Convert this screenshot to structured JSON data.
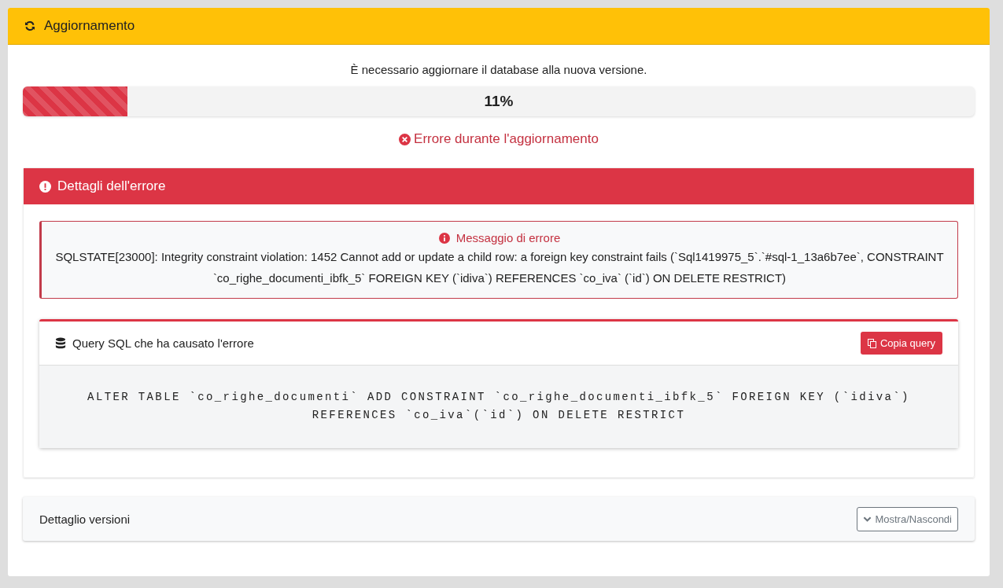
{
  "card": {
    "title": "Aggiornamento"
  },
  "intro": "È necessario aggiornare il database alla nuova versione.",
  "progress": {
    "level": 0.11,
    "reading": "11%"
  },
  "status": "Errore durante l'aggiornamento",
  "error_panel": {
    "title": "Dettagli dell'errore",
    "message": {
      "title": "Messaggio di errore",
      "text": "SQLSTATE[23000]: Integrity constraint violation: 1452 Cannot add or update a child row: a foreign key constraint fails (`Sql1419975_5`.`#sql-1_13a6b7ee`, CONSTRAINT `co_righe_documenti_ibfk_5` FOREIGN KEY (`idiva`) REFERENCES `co_iva` (`id`) ON DELETE RESTRICT)"
    },
    "query": {
      "title": "Query SQL che ha causato l'errore",
      "button": "Copia query",
      "sql": "ALTER TABLE `co_righe_documenti` ADD CONSTRAINT `co_righe_documenti_ibfk_5` FOREIGN KEY (`idiva`) REFERENCES `co_iva`(`id`) ON DELETE RESTRICT"
    }
  },
  "versions": {
    "title": "Dettaglio versioni",
    "button": "Mostra/Nascondi",
    "expanded": false
  }
}
